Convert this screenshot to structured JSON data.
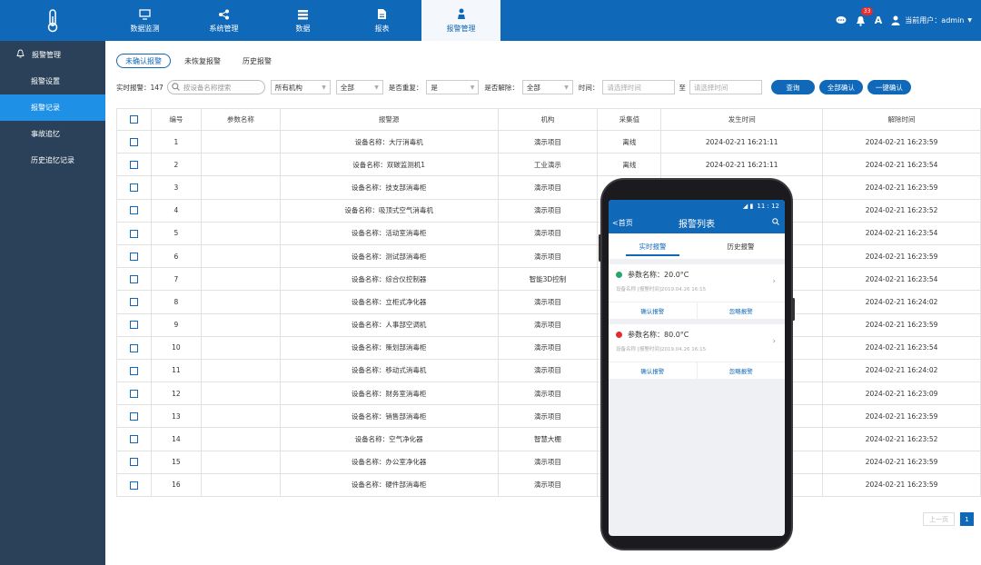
{
  "topnav": {
    "tabs": [
      {
        "label": "数据监测",
        "icon": "monitor-icon"
      },
      {
        "label": "系统管理",
        "icon": "share-icon"
      },
      {
        "label": "数据",
        "icon": "database-icon"
      },
      {
        "label": "报表",
        "icon": "file-icon"
      },
      {
        "label": "报警管理",
        "icon": "alarm-person-icon"
      }
    ],
    "active_index": 4,
    "notification_count": "33",
    "font_label": "A",
    "user_label": "当前用户：admin"
  },
  "sidebar": {
    "header": "报警管理",
    "items": [
      {
        "label": "报警设置"
      },
      {
        "label": "报警记录"
      },
      {
        "label": "事故追忆"
      },
      {
        "label": "历史追忆记录"
      }
    ],
    "active_index": 1
  },
  "tabs": [
    "未确认报警",
    "未恢复报警",
    "历史报警"
  ],
  "filters": {
    "realtime_label": "实时报警：147",
    "search_placeholder": "按设备名称搜索",
    "org_value": "所有机构",
    "all_value": "全部",
    "repeat_label": "是否重复：",
    "repeat_value": "是",
    "release_label": "是否解除：",
    "release_value": "全部",
    "time_label": "时间：",
    "time_from_placeholder": "请选择时间",
    "to_label": "至",
    "time_to_placeholder": "请选择时间",
    "query_btn": "查询",
    "confirm_all_btn": "全部确认",
    "one_key_btn": "一键确认"
  },
  "table": {
    "headers": [
      "编号",
      "参数名称",
      "报警源",
      "机构",
      "采集值",
      "发生时间",
      "解除时间"
    ],
    "rows": [
      [
        "1",
        "",
        "设备名称：大厅消毒机",
        "演示项目",
        "离线",
        "2024-02-21 16:21:11",
        "2024-02-21 16:23:59"
      ],
      [
        "2",
        "",
        "设备名称：双碳监测机1",
        "工业演示",
        "离线",
        "2024-02-21 16:21:11",
        "2024-02-21 16:23:54"
      ],
      [
        "3",
        "",
        "设备名称：技支部消毒柜",
        "演示项目",
        "离线",
        "2024-02-21 16:21:11",
        "2024-02-21 16:23:59"
      ],
      [
        "4",
        "",
        "设备名称：吸顶式空气消毒机",
        "演示项目",
        "",
        "",
        "2024-02-21 16:23:52"
      ],
      [
        "5",
        "",
        "设备名称：活动室消毒柜",
        "演示项目",
        "",
        "",
        "2024-02-21 16:23:54"
      ],
      [
        "6",
        "",
        "设备名称：测试部消毒柜",
        "演示项目",
        "",
        "",
        "2024-02-21 16:23:59"
      ],
      [
        "7",
        "",
        "设备名称：综合仪控制器",
        "智能3D控制",
        "",
        "",
        "2024-02-21 16:23:54"
      ],
      [
        "8",
        "",
        "设备名称：立柜式净化器",
        "演示项目",
        "",
        "",
        "2024-02-21 16:24:02"
      ],
      [
        "9",
        "",
        "设备名称：人事部空调机",
        "演示项目",
        "",
        "",
        "2024-02-21 16:23:59"
      ],
      [
        "10",
        "",
        "设备名称：策划部消毒柜",
        "演示项目",
        "",
        "",
        "2024-02-21 16:23:54"
      ],
      [
        "11",
        "",
        "设备名称：移动式消毒机",
        "演示项目",
        "",
        "",
        "2024-02-21 16:24:02"
      ],
      [
        "12",
        "",
        "设备名称：财务室消毒柜",
        "演示项目",
        "",
        "",
        "2024-02-21 16:23:09"
      ],
      [
        "13",
        "",
        "设备名称：销售部消毒柜",
        "演示项目",
        "",
        "",
        "2024-02-21 16:23:59"
      ],
      [
        "14",
        "",
        "设备名称：空气净化器",
        "智慧大棚",
        "",
        "",
        "2024-02-21 16:23:52"
      ],
      [
        "15",
        "",
        "设备名称：办公室净化器",
        "演示项目",
        "",
        "",
        "2024-02-21 16:23:59"
      ],
      [
        "16",
        "",
        "设备名称：硬件部消毒柜",
        "演示项目",
        "",
        "",
        "2024-02-21 16:23:59"
      ]
    ]
  },
  "pager": {
    "prev": "上一页",
    "current": "1"
  },
  "phone": {
    "status_time": "11 : 12",
    "back_label": "首页",
    "title": "报警列表",
    "tabs": [
      "实时报警",
      "历史报警"
    ],
    "cards": [
      {
        "title": "参数名称：20.0°C",
        "sub": "设备名称   [报警时间]2019.04.26 16:15",
        "dot_color": "#23a86b",
        "btn1": "确认报警",
        "btn2": "忽略报警"
      },
      {
        "title": "参数名称：80.0°C",
        "sub": "设备名称   [报警时间]2019.04.26 16:15",
        "dot_color": "#e02d2d",
        "btn1": "确认报警",
        "btn2": "忽略报警"
      }
    ]
  },
  "colors": {
    "primary": "#1068b8",
    "sidebar": "#2a4159",
    "sidebar_active": "#1e90e6"
  }
}
